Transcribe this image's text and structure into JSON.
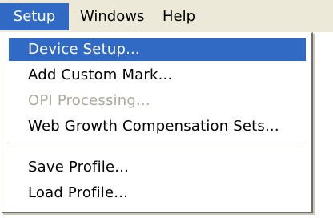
{
  "menubar": {
    "items": [
      {
        "label": "Setup"
      },
      {
        "label": "Windows"
      },
      {
        "label": "Help"
      }
    ]
  },
  "setup_menu": {
    "items": [
      {
        "label": "Device Setup..."
      },
      {
        "label": "Add Custom Mark..."
      },
      {
        "label": "OPI Processing..."
      },
      {
        "label": "Web Growth Compensation Sets..."
      },
      {
        "label": "Save Profile..."
      },
      {
        "label": "Load Profile..."
      }
    ]
  },
  "colors": {
    "highlight": "#316ac5",
    "menubar_bg": "#ece9d8",
    "disabled_text": "#aca899"
  }
}
